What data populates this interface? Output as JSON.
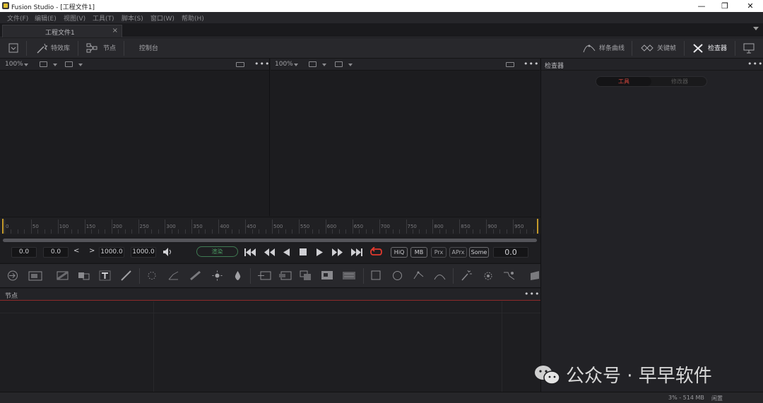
{
  "window": {
    "title": "Fusion Studio - [工程文件1]",
    "minimize": "—",
    "maximize": "❐",
    "close": "✕"
  },
  "menu": [
    "文件(F)",
    "编辑(E)",
    "视图(V)",
    "工具(T)",
    "脚本(S)",
    "窗口(W)",
    "帮助(H)"
  ],
  "tab": {
    "label": "工程文件1",
    "close": "×"
  },
  "toolbar": {
    "effects": "特效库",
    "nodes": "节点",
    "console": "控制台",
    "spline": "样条曲线",
    "keyframes": "关键帧",
    "inspector": "检查器"
  },
  "viewer_left": {
    "zoom": "100%",
    "dots": "•••"
  },
  "viewer_right": {
    "zoom": "100%",
    "dots": "•••"
  },
  "inspector": {
    "title": "检查器",
    "tab_tools": "工具",
    "tab_modifiers": "修改器",
    "dots": "•••"
  },
  "ruler": {
    "labels": [
      "0",
      "50",
      "100",
      "150",
      "200",
      "250",
      "300",
      "350",
      "400",
      "450",
      "500",
      "550",
      "600",
      "650",
      "700",
      "750",
      "800",
      "850",
      "900",
      "950"
    ]
  },
  "transport": {
    "global_start": "0.0",
    "render_start": "0.0",
    "render_end": "1000.0",
    "global_end": "1000.0",
    "prev": "<",
    "next": ">",
    "render": "渲染",
    "hiq": "HiQ",
    "mb": "MB",
    "prx": "Prx",
    "aprx": "APrx",
    "some": "Some",
    "current_time": "0.0"
  },
  "nodes": {
    "title": "节点",
    "dots": "•••"
  },
  "status": {
    "memory": "3% - 514 MB",
    "state": "闲置"
  },
  "watermark": "公众号 · 早早软件"
}
